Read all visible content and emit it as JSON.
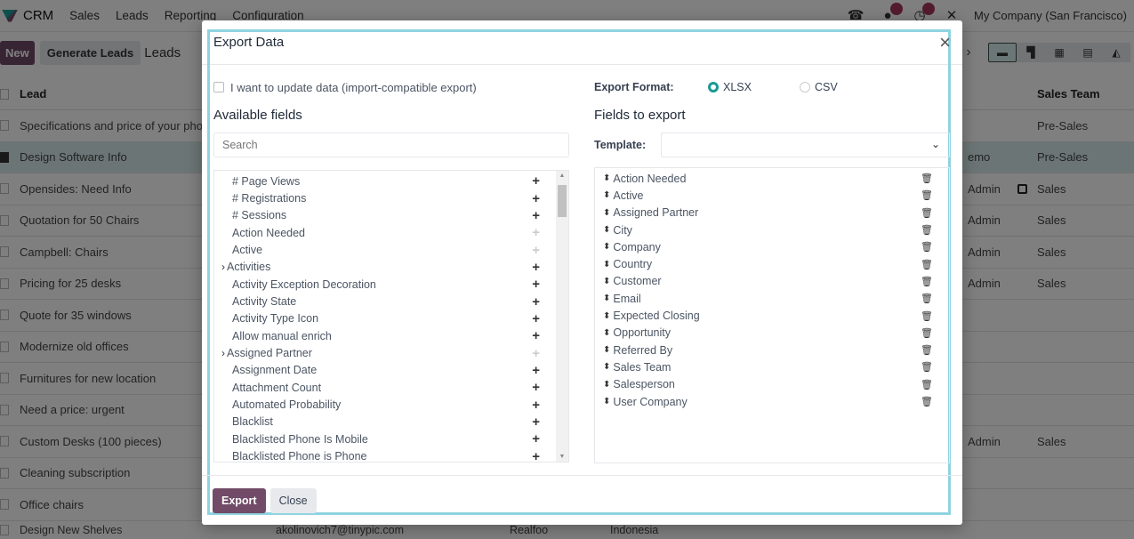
{
  "topbar": {
    "app_name": "CRM",
    "menu": [
      "Sales",
      "Leads",
      "Reporting",
      "Configuration"
    ],
    "company": "My Company (San Francisco)",
    "icons": [
      "phone-icon",
      "chat-icon",
      "activity-clock-icon",
      "tools-icon"
    ]
  },
  "controlbar": {
    "new_label": "New",
    "generate_label": "Generate Leads",
    "breadcrumb": "Leads",
    "views": [
      "list-view",
      "kanban-view",
      "calendar-view",
      "pivot-view",
      "graph-view"
    ]
  },
  "list": {
    "headers": {
      "lead": "Lead",
      "sales_team": "Sales Team"
    },
    "rows": [
      {
        "lead": "Specifications and price of your phone",
        "user": "",
        "team": "Pre-Sales",
        "checked": false
      },
      {
        "lead": "Design Software Info",
        "user": "emo",
        "team": "Pre-Sales",
        "checked": true
      },
      {
        "lead": "Opensides: Need Info",
        "user": "Admin",
        "team": "Sales",
        "checked": false
      },
      {
        "lead": "Quotation for 50 Chairs",
        "user": "Admin",
        "team": "Sales",
        "checked": false
      },
      {
        "lead": "Campbell: Chairs",
        "user": "Admin",
        "team": "Sales",
        "checked": false
      },
      {
        "lead": "Pricing for 25 desks",
        "user": "Admin",
        "team": "Sales",
        "checked": false
      },
      {
        "lead": "Quote for 35 windows",
        "user": "",
        "team": "",
        "checked": false
      },
      {
        "lead": "Modernize old offices",
        "user": "",
        "team": "",
        "checked": false
      },
      {
        "lead": "Furnitures for new location",
        "user": "",
        "team": "",
        "checked": false
      },
      {
        "lead": "Need a price: urgent",
        "user": "",
        "team": "",
        "checked": false
      },
      {
        "lead": "Custom Desks (100 pieces)",
        "user": "Admin",
        "team": "Sales",
        "checked": false
      },
      {
        "lead": "Cleaning subscription",
        "user": "",
        "team": "",
        "checked": false
      },
      {
        "lead": "Office chairs",
        "user": "",
        "team": "",
        "checked": false
      }
    ],
    "partial_row": {
      "lead": "Design New Shelves",
      "email": "akolinovich7@tinypic.com",
      "company": "Realfoo",
      "country": "Indonesia"
    }
  },
  "modal": {
    "title": "Export Data",
    "import_compatible_label": "I want to update data (import-compatible export)",
    "import_compatible_checked": false,
    "available_title": "Available fields",
    "search_placeholder": "Search",
    "available_fields": [
      {
        "label": "# Page Views",
        "expandable": false,
        "addable": true
      },
      {
        "label": "# Registrations",
        "expandable": false,
        "addable": true
      },
      {
        "label": "# Sessions",
        "expandable": false,
        "addable": true
      },
      {
        "label": "Action Needed",
        "expandable": false,
        "addable": false
      },
      {
        "label": "Active",
        "expandable": false,
        "addable": false
      },
      {
        "label": "Activities",
        "expandable": true,
        "addable": true
      },
      {
        "label": "Activity Exception Decoration",
        "expandable": false,
        "addable": true
      },
      {
        "label": "Activity State",
        "expandable": false,
        "addable": true
      },
      {
        "label": "Activity Type Icon",
        "expandable": false,
        "addable": true
      },
      {
        "label": "Allow manual enrich",
        "expandable": false,
        "addable": true
      },
      {
        "label": "Assigned Partner",
        "expandable": true,
        "addable": false
      },
      {
        "label": "Assignment Date",
        "expandable": false,
        "addable": true
      },
      {
        "label": "Attachment Count",
        "expandable": false,
        "addable": true
      },
      {
        "label": "Automated Probability",
        "expandable": false,
        "addable": true
      },
      {
        "label": "Blacklist",
        "expandable": false,
        "addable": true
      },
      {
        "label": "Blacklisted Phone Is Mobile",
        "expandable": false,
        "addable": true
      },
      {
        "label": "Blacklisted Phone is Phone",
        "expandable": false,
        "addable": true
      }
    ],
    "export_format_label": "Export Format:",
    "formats": [
      {
        "label": "XLSX",
        "selected": true
      },
      {
        "label": "CSV",
        "selected": false
      }
    ],
    "fields_to_export_title": "Fields to export",
    "template_label": "Template:",
    "template_value": "",
    "export_fields": [
      "Action Needed",
      "Active",
      "Assigned Partner",
      "City",
      "Company",
      "Country",
      "Customer",
      "Email",
      "Expected Closing",
      "Opportunity",
      "Referred By",
      "Sales Team",
      "Salesperson",
      "User Company"
    ],
    "export_button": "Export",
    "close_button": "Close"
  },
  "colors": {
    "brand": "#714b67",
    "accent_teal": "#1a9a93",
    "focus_ring": "#8fd3e0",
    "selected_row": "#d8ebea"
  }
}
